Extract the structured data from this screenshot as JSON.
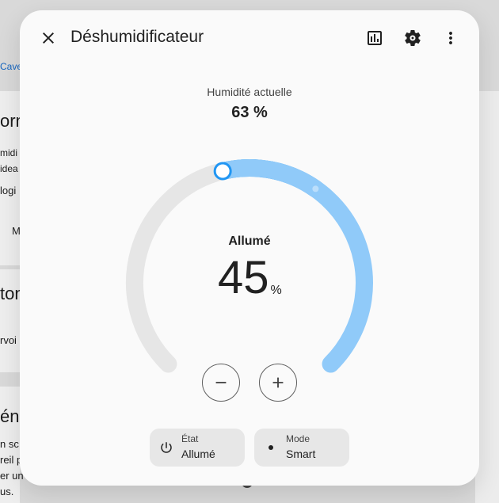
{
  "background": {
    "breadcrumb": "Cave",
    "heading_1": "orm",
    "line_1": "midi",
    "line_2": "idea",
    "line_3": "logi",
    "line_4": "M",
    "heading_2": "ton",
    "line_5": "rvoi",
    "heading_3": "éne",
    "line_6": "n sc",
    "line_7": "reil p",
    "line_8": "er un",
    "line_9": "us."
  },
  "dialog": {
    "title": "Déshumidificateur",
    "icons": {
      "close": "close-icon",
      "history": "chart-box-icon",
      "settings": "gear-icon",
      "more": "dots-vertical-icon"
    }
  },
  "current_humidity": {
    "label": "Humidité actuelle",
    "value": "63 %",
    "value_pct": 63
  },
  "target": {
    "state": "Allumé",
    "value": "45",
    "unit": "%",
    "value_pct": 45
  },
  "chips": {
    "state": {
      "label": "État",
      "value": "Allumé",
      "icon": "power-icon"
    },
    "mode": {
      "label": "Mode",
      "value": "Smart",
      "icon": "dot-icon"
    }
  },
  "colors": {
    "accent": "#2196f3",
    "accent_light": "#90caf9",
    "track": "#e6e6e6",
    "dialog_bg": "#fafafa"
  }
}
